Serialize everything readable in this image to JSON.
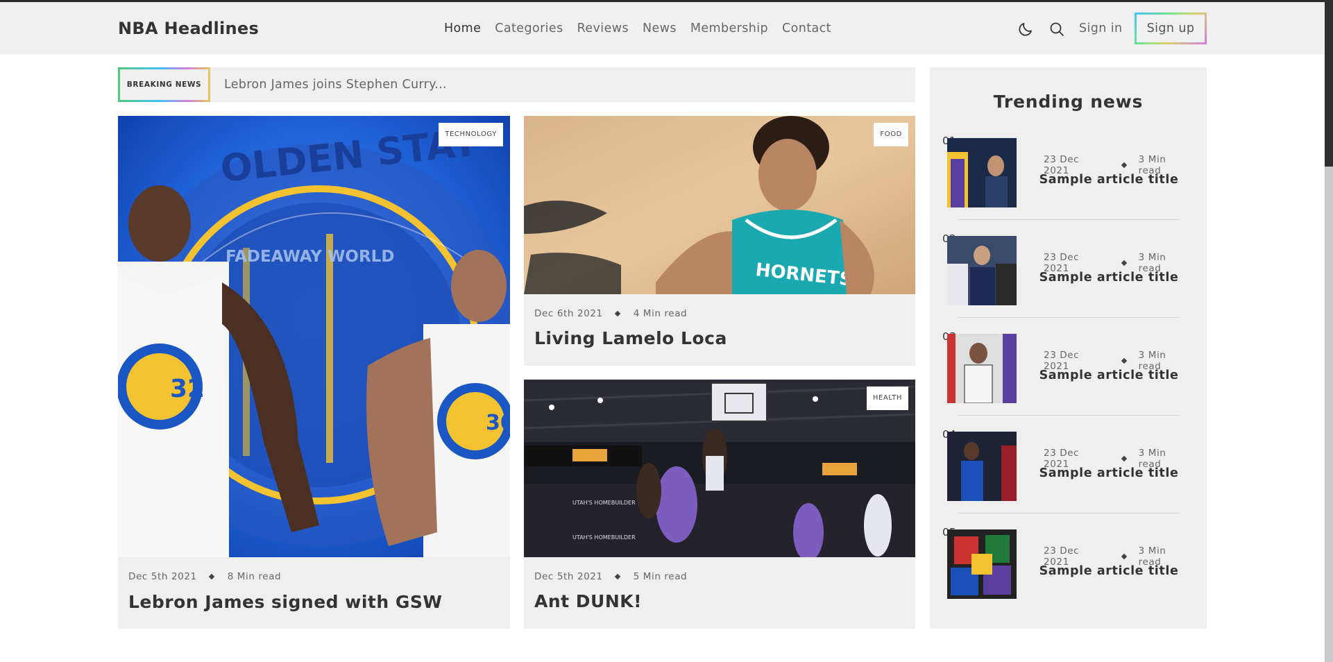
{
  "header": {
    "logo": "NBA Headlines",
    "nav": [
      "Home",
      "Categories",
      "Reviews",
      "News",
      "Membership",
      "Contact"
    ],
    "active_nav": "Home",
    "sign_in": "Sign in",
    "sign_up": "Sign up",
    "icons": [
      "moon-icon",
      "search-icon"
    ]
  },
  "breaking": {
    "label": "BREAKING NEWS",
    "text": "Lebron James joins Stephen Curry..."
  },
  "main_card": {
    "tag": "TECHNOLOGY",
    "date": "Dec 5th 2021",
    "read_time": "8 Min read",
    "title": "Lebron James signed with GSW",
    "image_text": "FADEAWAY WORLD"
  },
  "card_top": {
    "tag": "FOOD",
    "date": "Dec 6th 2021",
    "read_time": "4 Min read",
    "title": "Living Lamelo Loca",
    "image_text": "HORNETS"
  },
  "card_bottom": {
    "tag": "HEALTH",
    "date": "Dec 5th 2021",
    "read_time": "5 Min read",
    "title": "Ant DUNK!"
  },
  "trending": {
    "title": "Trending news",
    "items": [
      {
        "num": "01",
        "date": "23 Dec 2021",
        "read_time": "3 Min read",
        "title": "Sample article title"
      },
      {
        "num": "02",
        "date": "23 Dec 2021",
        "read_time": "3 Min read",
        "title": "Sample article title"
      },
      {
        "num": "03",
        "date": "23 Dec 2021",
        "read_time": "3 Min read",
        "title": "Sample article title"
      },
      {
        "num": "04",
        "date": "23 Dec 2021",
        "read_time": "3 Min read",
        "title": "Sample article title"
      },
      {
        "num": "05",
        "date": "23 Dec 2021",
        "read_time": "3 Min read",
        "title": "Sample article title"
      }
    ]
  },
  "colors": {
    "header_bg": "#f0f0f0",
    "card_bg": "#efefef",
    "text_dark": "#333333",
    "text_muted": "#666666"
  }
}
